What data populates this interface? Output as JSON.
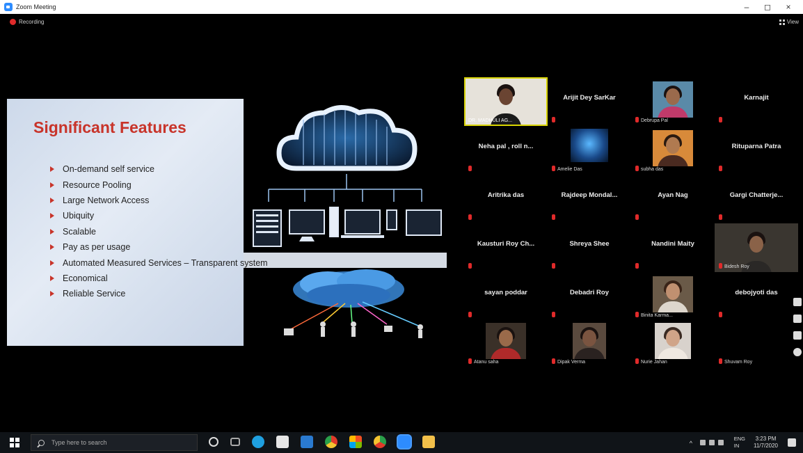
{
  "window": {
    "title": "Zoom Meeting",
    "controls": [
      "–",
      "◻",
      "×"
    ]
  },
  "meeting": {
    "recording_label": "Recording",
    "view_label": "View"
  },
  "slide": {
    "title": "Significant Features",
    "bullets": [
      "On-demand self service",
      "Resource Pooling",
      "Large Network Access",
      "Ubiquity",
      "Scalable",
      "Pay as per usage",
      "Automated Measured Services – Transparent system",
      "Economical",
      "Reliable Service"
    ],
    "accent_color": "#c8342a"
  },
  "participants": [
    {
      "name": "DR. MADHULI AG...",
      "video": true,
      "row": 0,
      "col": 0
    },
    {
      "name": "Arijit Dey SarKar",
      "video": false
    },
    {
      "name": "Debrupa Pal",
      "video": true
    },
    {
      "name": "Karnajit",
      "video": false
    },
    {
      "name": "Neha pal , roll n...",
      "video": false
    },
    {
      "name": "Amelie Das",
      "video": true
    },
    {
      "name": "subha das",
      "video": true
    },
    {
      "name": "Rituparna Patra",
      "video": false
    },
    {
      "name": "Aritrika das",
      "video": false
    },
    {
      "name": "Rajdeep  Mondal...",
      "video": false
    },
    {
      "name": "Ayan Nag",
      "video": false
    },
    {
      "name": "Gargi  Chatterje...",
      "video": false
    },
    {
      "name": "Kausturi Roy Ch...",
      "video": false
    },
    {
      "name": "Shreya Shee",
      "video": false
    },
    {
      "name": "Nandini Maity",
      "video": false
    },
    {
      "name": "Bidesh Roy",
      "video": true
    },
    {
      "name": "sayan poddar",
      "video": false
    },
    {
      "name": "Debadri Roy",
      "video": false
    },
    {
      "name": "Binita Karma...",
      "video": true
    },
    {
      "name": "debojyoti das",
      "video": false
    },
    {
      "name": "Atanu saha",
      "video": true
    },
    {
      "name": "Dipak Verma",
      "video": true
    },
    {
      "name": "Nurie Jahan",
      "video": true
    },
    {
      "name": "Shuvam Roy",
      "video": false
    }
  ],
  "taskbar": {
    "search_placeholder": "Type here to search",
    "language_top": "ENG",
    "language_bottom": "IN",
    "time": "3:23 PM",
    "date": "11/7/2020"
  }
}
